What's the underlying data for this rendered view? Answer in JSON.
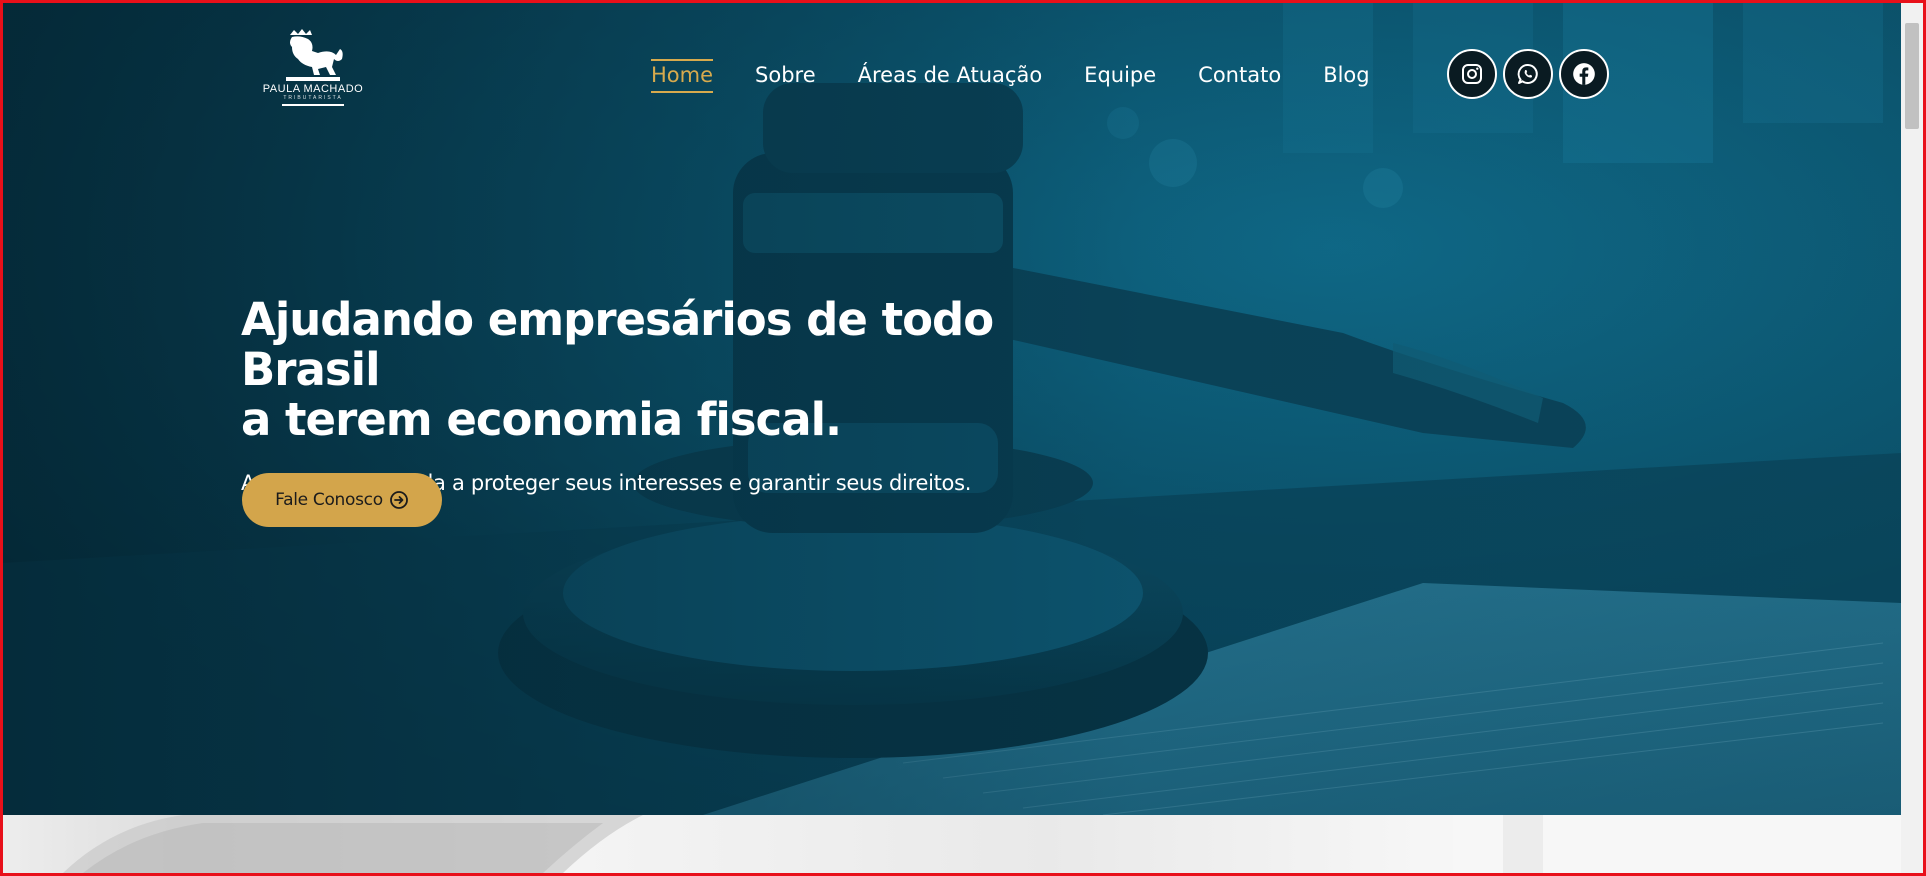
{
  "logo": {
    "name": "PAULA MACHADO",
    "subtitle": "TRIBUTARISTA",
    "icon": "lion-crown-icon"
  },
  "nav": {
    "items": [
      {
        "label": "Home",
        "active": true
      },
      {
        "label": "Sobre",
        "active": false
      },
      {
        "label": "Áreas de Atuação",
        "active": false
      },
      {
        "label": "Equipe",
        "active": false
      },
      {
        "label": "Contato",
        "active": false
      },
      {
        "label": "Blog",
        "active": false
      }
    ],
    "active_color": "#d7aa4d"
  },
  "socials": [
    {
      "icon": "instagram-icon"
    },
    {
      "icon": "whatsapp-icon"
    },
    {
      "icon": "facebook-icon"
    }
  ],
  "hero": {
    "title_line1": "Ajudando empresários de todo Brasil",
    "title_line2": "a terem economia fiscal.",
    "subtitle": "Advocacia dedicada a proteger seus interesses e garantir seus direitos.",
    "cta_label": "Fale Conosco",
    "cta_icon": "arrow-circle-right-icon",
    "cta_color": "#d3a54b"
  }
}
